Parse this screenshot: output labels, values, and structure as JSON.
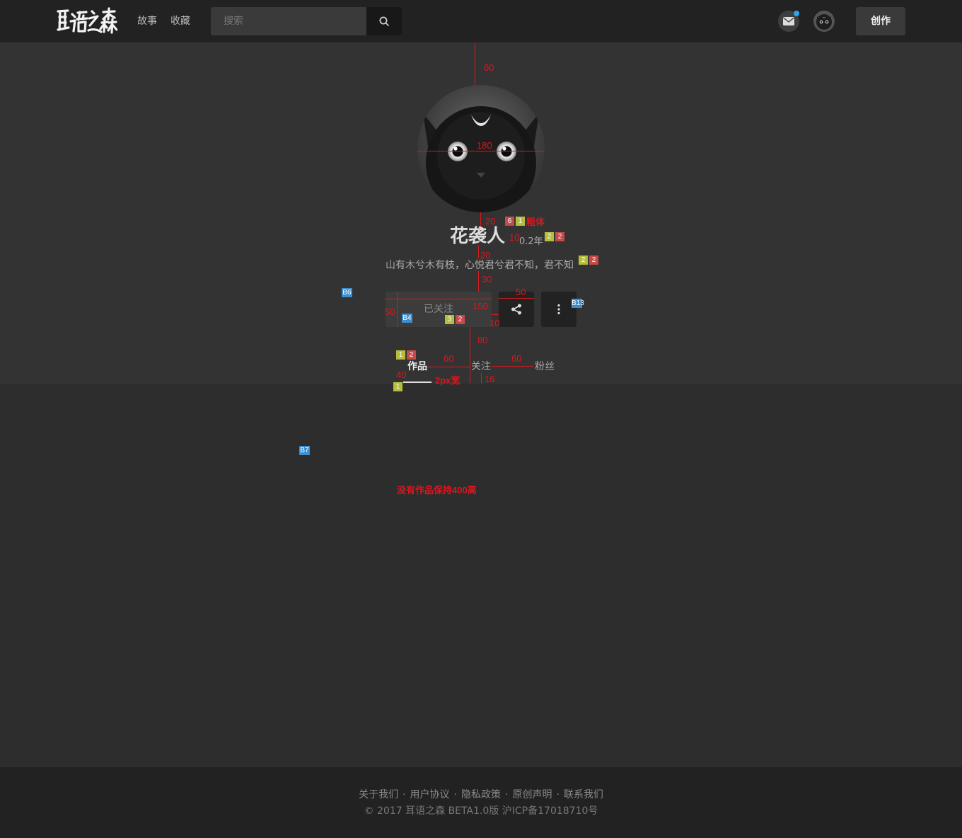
{
  "header": {
    "logo_text": "耳语之森",
    "nav": [
      "故事",
      "收藏"
    ],
    "search_placeholder": "搜索",
    "create_label": "创作"
  },
  "profile": {
    "username": "花袭人",
    "age": "0.2年",
    "bio": "山有木兮木有枝，心悦君兮君不知，君不知",
    "follow_label": "已关注",
    "tabs": [
      "作品",
      "关注",
      "粉丝"
    ]
  },
  "annotations": {
    "top_gap": "60",
    "avatar_size": "180",
    "gap_name": "20",
    "gap_age": "10",
    "gap_bio": "20",
    "gap_buttons": "30",
    "icon_btn_size": "50",
    "btn_height": "50",
    "follow_width": "150",
    "btn_gap": "10",
    "gap_tabs": "80",
    "tab_gap_1": "60",
    "tab_gap_2": "60",
    "underline_width": "40",
    "underline_desc": "2px宽",
    "tab_bottom": "16",
    "bold_note": "粗体",
    "empty_note": "没有作品保持400高",
    "tags": {
      "name_a": "6",
      "name_b": "1",
      "age_a": "2",
      "age_b": "2",
      "bio_a": "2",
      "bio_b": "2",
      "follow_a": "3",
      "follow_b": "2",
      "tab_a": "1",
      "tab_b": "2",
      "line_a": "1",
      "b6": "B6",
      "b4": "B4",
      "b13": "B13",
      "b7": "B7"
    }
  },
  "footer": {
    "links": [
      "关于我们",
      "用户协议",
      "隐私政策",
      "原创声明",
      "联系我们"
    ],
    "separator": "·",
    "copyright": "© 2017 耳语之森 BETA1.0版 沪ICP备17018710号"
  },
  "colors": {
    "header_bg": "#222222",
    "profile_bg": "#333333",
    "content_bg": "#2d2d2d",
    "annotation": "#e0141c",
    "notification_dot": "#2ba6f0"
  },
  "icons": [
    "search-icon",
    "mail-icon",
    "share-icon",
    "more-vertical-icon",
    "cat-avatar"
  ]
}
